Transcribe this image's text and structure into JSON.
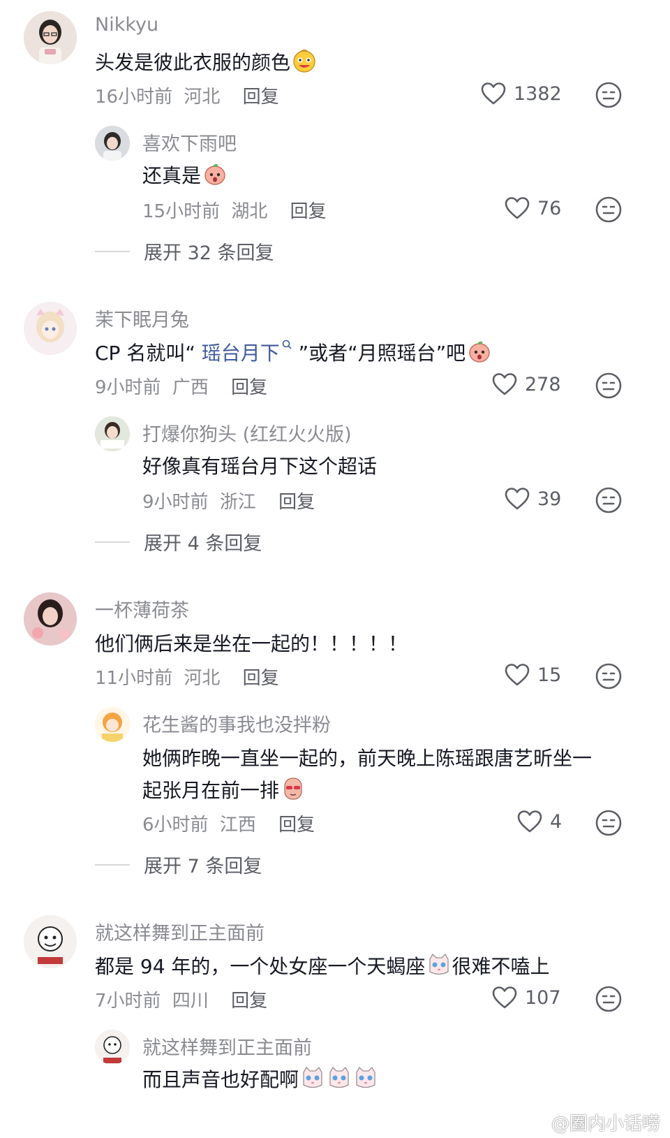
{
  "comments": [
    {
      "user": "Nikkyu",
      "text": "头发是彼此衣服的颜色",
      "time": "16小时前",
      "location": "河北",
      "reply_label": "回复",
      "likes": "1382",
      "replies": [
        {
          "user": "喜欢下雨吧",
          "text": "还真是",
          "time": "15小时前",
          "location": "湖北",
          "reply_label": "回复",
          "likes": "76"
        }
      ],
      "expand": "展开 32 条回复"
    },
    {
      "user": "茉下眠月兔",
      "text_before": "CP 名就叫“ ",
      "text_link": "瑶台月下",
      "text_after": " ”或者“月照瑶台”吧",
      "time": "9小时前",
      "location": "广西",
      "reply_label": "回复",
      "likes": "278",
      "replies": [
        {
          "user": "打爆你狗头 (红红火火版)",
          "text": "好像真有瑶台月下这个超话",
          "time": "9小时前",
          "location": "浙江",
          "reply_label": "回复",
          "likes": "39"
        }
      ],
      "expand": "展开 4 条回复"
    },
    {
      "user": "一杯薄荷茶",
      "text": "他们俩后来是坐在一起的！！！！！",
      "time": "11小时前",
      "location": "河北",
      "reply_label": "回复",
      "likes": "15",
      "replies": [
        {
          "user": "花生酱的事我也没拌粉",
          "text_line1": "她俩昨晚一直坐一起的，前天晚上陈瑶跟唐艺昕坐一",
          "text_line2": "起张月在前一排",
          "time": "6小时前",
          "location": "江西",
          "reply_label": "回复",
          "likes": "4"
        }
      ],
      "expand": "展开 7 条回复"
    },
    {
      "user": "就这样舞到正主面前",
      "text_before": "都是 94 年的，一个处女座一个天蝎座",
      "text_after": "很难不嗑上",
      "time": "7小时前",
      "location": "四川",
      "reply_label": "回复",
      "likes": "107",
      "replies": [
        {
          "user": "就这样舞到正主面前",
          "text": "而且声音也好配啊"
        }
      ]
    }
  ],
  "watermark": "@圈内小话唠",
  "icons": {
    "like": "heart-outline-icon",
    "dislike": "neutral-face-icon"
  },
  "colors": {
    "name": "#8a8b91",
    "text": "#161823",
    "link": "#3d5a9c"
  }
}
